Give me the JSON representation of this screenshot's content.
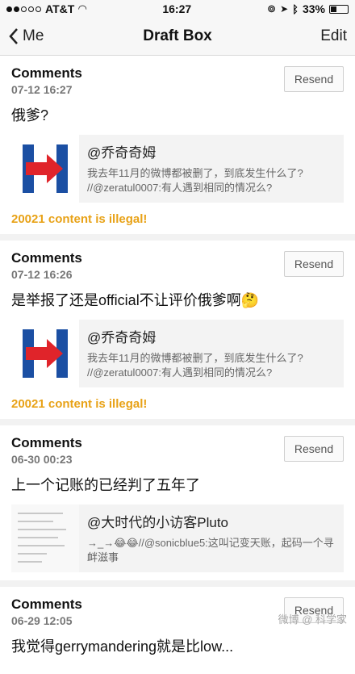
{
  "status": {
    "carrier": "AT&T",
    "time": "16:27",
    "battery": "33%",
    "battery_level": 0.33
  },
  "nav": {
    "back_label": "Me",
    "title": "Draft Box",
    "edit_label": "Edit"
  },
  "items": [
    {
      "type": "Comments",
      "time": "07-12 16:27",
      "resend": "Resend",
      "text": "俄爹?",
      "quote": {
        "author": "@乔奇奇姆",
        "text": "我去年11月的微博都被删了，到底发生什么了? //@zeratul0007:有人遇到相同的情况么?"
      },
      "error": "20021 content is illegal!"
    },
    {
      "type": "Comments",
      "time": "07-12 16:26",
      "resend": "Resend",
      "text": "是举报了还是official不让评价俄爹啊🤔",
      "quote": {
        "author": "@乔奇奇姆",
        "text": "我去年11月的微博都被删了，到底发生什么了? //@zeratul0007:有人遇到相同的情况么?"
      },
      "error": "20021 content is illegal!"
    },
    {
      "type": "Comments",
      "time": "06-30 00:23",
      "resend": "Resend",
      "text": "上一个记账的已经判了五年了",
      "quote": {
        "author": "@大时代的小访客Pluto",
        "text": "→_→😂😂//@sonicblue5:这叫记变天账，起码一个寻衅滋事"
      }
    },
    {
      "type": "Comments",
      "time": "06-29 12:05",
      "resend": "Resend",
      "text": "我觉得gerrymandering就是比low..."
    }
  ],
  "watermark": "微博 @ 科学家"
}
